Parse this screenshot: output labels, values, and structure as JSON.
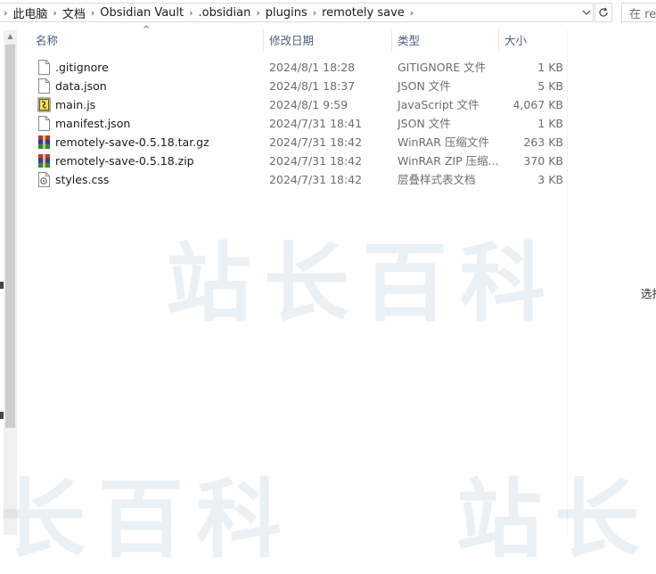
{
  "breadcrumb": {
    "items": [
      "此电脑",
      "文档",
      "Obsidian Vault",
      ".obsidian",
      "plugins",
      "remotely save"
    ],
    "separator": "›",
    "dropdown_icon": "chevron-down-icon",
    "refresh_icon": "refresh-icon"
  },
  "search": {
    "placeholder": "在 re"
  },
  "columns": {
    "name": "名称",
    "date": "修改日期",
    "type": "类型",
    "size": "大小"
  },
  "files": [
    {
      "name": ".gitignore",
      "date": "2024/8/1 18:28",
      "type": "GITIGNORE 文件",
      "size": "1 KB",
      "icon": "blank-file-icon"
    },
    {
      "name": "data.json",
      "date": "2024/8/1 18:37",
      "type": "JSON 文件",
      "size": "5 KB",
      "icon": "blank-file-icon"
    },
    {
      "name": "main.js",
      "date": "2024/8/1 9:59",
      "type": "JavaScript 文件",
      "size": "4,067 KB",
      "icon": "script-file-icon"
    },
    {
      "name": "manifest.json",
      "date": "2024/7/31 18:41",
      "type": "JSON 文件",
      "size": "1 KB",
      "icon": "blank-file-icon"
    },
    {
      "name": "remotely-save-0.5.18.tar.gz",
      "date": "2024/7/31 18:42",
      "type": "WinRAR 压缩文件",
      "size": "263 KB",
      "icon": "winrar-archive-icon"
    },
    {
      "name": "remotely-save-0.5.18.zip",
      "date": "2024/7/31 18:42",
      "type": "WinRAR ZIP 压缩...",
      "size": "370 KB",
      "icon": "winrar-archive-icon"
    },
    {
      "name": "styles.css",
      "date": "2024/7/31 18:42",
      "type": "层叠样式表文档",
      "size": "3 KB",
      "icon": "css-file-icon"
    }
  ],
  "side_panel": {
    "text": "选择"
  },
  "watermark": "站长百科",
  "colors": {
    "header_text": "#4c607a",
    "meta_text": "#6d6d6d",
    "archive_red": "#c0392b",
    "archive_blue": "#2c3e9e"
  }
}
